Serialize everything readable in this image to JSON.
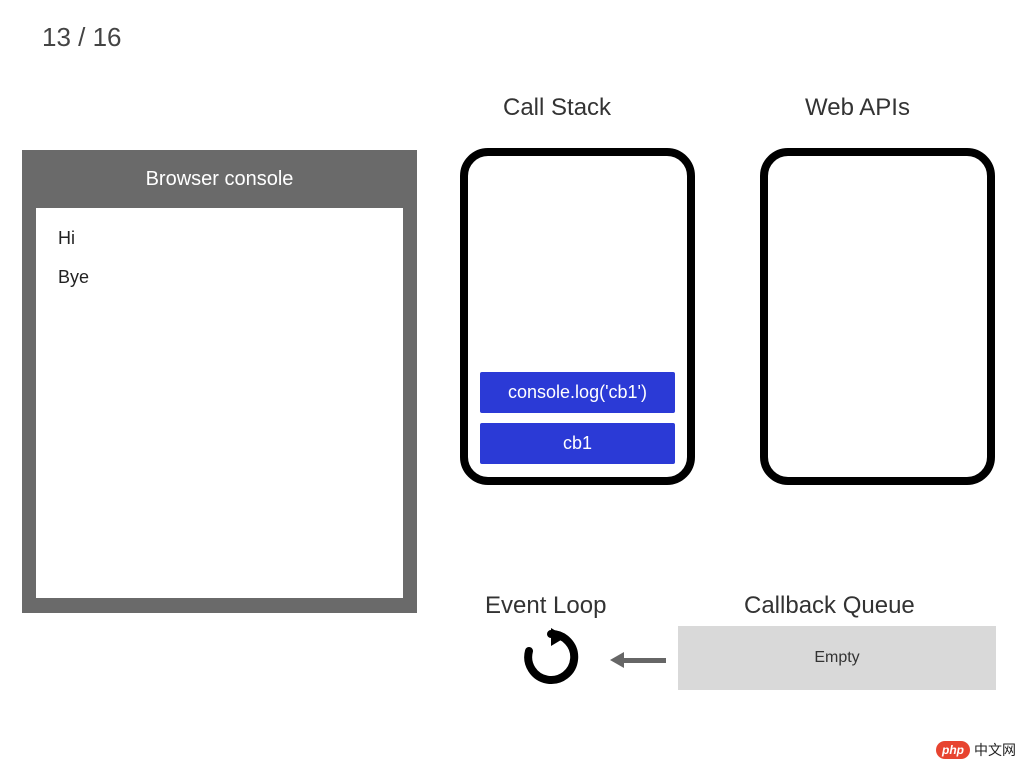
{
  "step": {
    "current": 13,
    "total": 16,
    "display": "13 / 16"
  },
  "headings": {
    "call_stack": "Call Stack",
    "web_apis": "Web APIs",
    "event_loop": "Event Loop",
    "callback_queue": "Callback Queue"
  },
  "console": {
    "title": "Browser console",
    "lines": [
      "Hi",
      "Bye"
    ]
  },
  "call_stack": {
    "frames": [
      "console.log('cb1')",
      "cb1"
    ]
  },
  "web_apis": {
    "items": []
  },
  "callback_queue": {
    "status": "Empty",
    "items": []
  },
  "watermark": {
    "badge": "php",
    "text": "中文网"
  }
}
